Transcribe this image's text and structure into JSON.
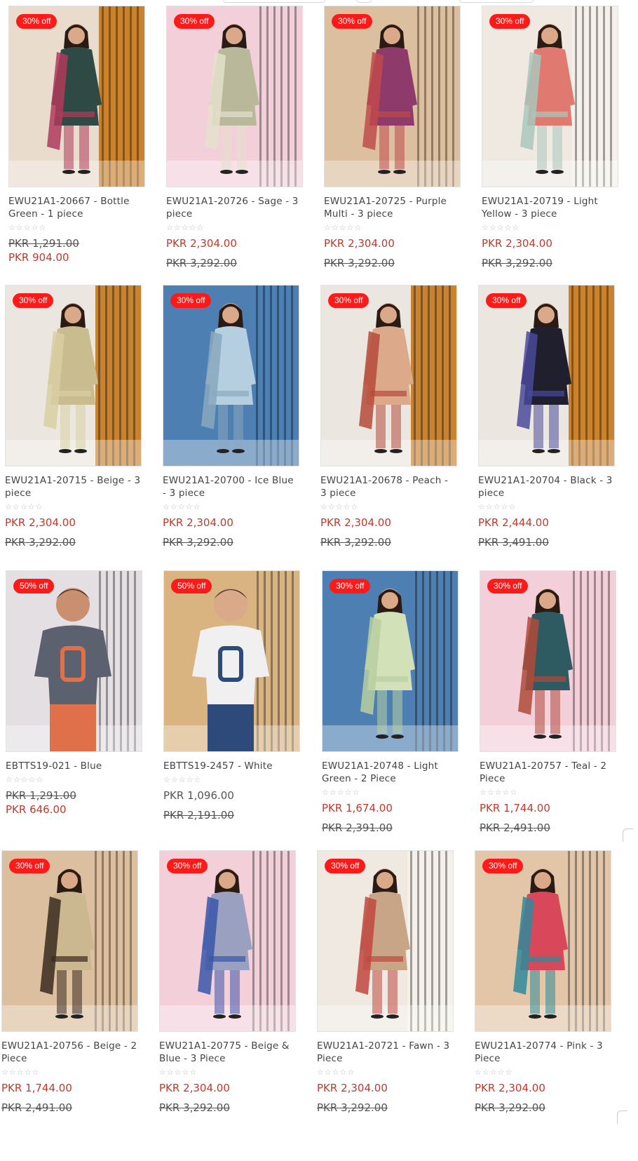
{
  "products": [
    {
      "badge": "30% off",
      "title": "EWU21A1-20667 - Bottle Green - 1 piece",
      "price": "PKR 904.00",
      "old_price": "PKR 1,291.00",
      "layout": "inline",
      "bg": "#e9dccd",
      "dress": "#2f4a45",
      "accent": "#b03a5b",
      "curtain": "#c9822e",
      "skin": "#d9a98a"
    },
    {
      "badge": "30% off",
      "title": "EWU21A1-20726 - Sage - 3 piece",
      "price": "PKR 2,304.00",
      "old_price": "PKR 3,292.00",
      "layout": "stack",
      "bg": "#f3cfda",
      "dress": "#b9b89a",
      "accent": "#e4e0cc",
      "curtain": "#f3cfda",
      "skin": "#d9a98a"
    },
    {
      "badge": "30% off",
      "title": "EWU21A1-20725 - Purple Multi - 3 piece",
      "price": "PKR 2,304.00",
      "old_price": "PKR 3,292.00",
      "layout": "stack",
      "bg": "#dcbf9e",
      "dress": "#8e3a6a",
      "accent": "#c04a4a",
      "curtain": "#dcbf9e",
      "skin": "#d9a98a"
    },
    {
      "badge": "30% off",
      "title": "EWU21A1-20719 - Light Yellow - 3 piece",
      "price": "PKR 2,304.00",
      "old_price": "PKR 3,292.00",
      "layout": "stack",
      "bg": "#efe9e2",
      "dress": "#e0796f",
      "accent": "#a9c7bb",
      "curtain": "#f5f1ea",
      "skin": "#d9a98a"
    },
    {
      "badge": "30% off",
      "title": "EWU21A1-20715 - Beige - 3 piece",
      "price": "PKR 2,304.00",
      "old_price": "PKR 3,292.00",
      "layout": "stack",
      "bg": "#ece6e0",
      "dress": "#c9bd90",
      "accent": "#d8cfa2",
      "curtain": "#c9822e",
      "skin": "#d9a98a"
    },
    {
      "badge": "30% off",
      "title": "EWU21A1-20700 - Ice Blue - 3 piece",
      "price": "PKR 2,304.00",
      "old_price": "PKR 3,292.00",
      "layout": "stack",
      "bg": "#4d7fb2",
      "dress": "#b6cfe0",
      "accent": "#8aa8bd",
      "curtain": "#4d7fb2",
      "skin": "#d9a98a"
    },
    {
      "badge": "30% off",
      "title": "EWU21A1-20678 - Peach - 3 piece",
      "price": "PKR 2,304.00",
      "old_price": "PKR 3,292.00",
      "layout": "stack",
      "bg": "#ece6e0",
      "dress": "#dca98b",
      "accent": "#b54a3a",
      "curtain": "#c9822e",
      "skin": "#d9a98a"
    },
    {
      "badge": "30% off",
      "title": "EWU21A1-20704 - Black - 3 piece",
      "price": "PKR 2,444.00",
      "old_price": "PKR 3,491.00",
      "layout": "stack",
      "bg": "#ece6e0",
      "dress": "#1f1f2e",
      "accent": "#4a4a9a",
      "curtain": "#c9822e",
      "skin": "#d9a98a"
    },
    {
      "badge": "50% off",
      "title": "EBTTS19-021 - Blue",
      "price": "PKR 646.00",
      "old_price": "PKR 1,291.00",
      "layout": "inline",
      "bg": "#e4dfe3",
      "dress": "#5c6170",
      "accent": "#e0704a",
      "curtain": "#e4dfe3",
      "skin": "#c98f6e"
    },
    {
      "badge": "50% off",
      "title": "EBTTS19-2457 - White",
      "price": "PKR 1,096.00",
      "old_price": "PKR 2,191.00",
      "layout": "stack-plain",
      "bg": "#d9b481",
      "dress": "#f0f0f0",
      "accent": "#2e4a7a",
      "curtain": "#d9b481",
      "skin": "#d9a98a"
    },
    {
      "badge": "30% off",
      "title": "EWU21A1-20748 - Light Green - 2 Piece",
      "price": "PKR 1,674.00",
      "old_price": "PKR 2,391.00",
      "layout": "stack",
      "bg": "#4d7fb2",
      "dress": "#d3e1b8",
      "accent": "#b8cfa0",
      "curtain": "#4d7fb2",
      "skin": "#d9a98a"
    },
    {
      "badge": "30% off",
      "title": "EWU21A1-20757 - Teal - 2 Piece",
      "price": "PKR 1,744.00",
      "old_price": "PKR 2,491.00",
      "layout": "stack",
      "bg": "#f3cfda",
      "dress": "#2e5a62",
      "accent": "#b04a3a",
      "curtain": "#f3cfda",
      "skin": "#d9a98a"
    },
    {
      "badge": "30% off",
      "title": "EWU21A1-20756 - Beige - 2 Piece",
      "price": "PKR 1,744.00",
      "old_price": "PKR 2,491.00",
      "layout": "stack",
      "bg": "#dcbf9e",
      "dress": "#cbb890",
      "accent": "#3a2a20",
      "curtain": "#dcbf9e",
      "skin": "#d9a98a"
    },
    {
      "badge": "30% off",
      "title": "EWU21A1-20775 - Beige & Blue - 3 Piece",
      "price": "PKR 2,304.00",
      "old_price": "PKR 3,292.00",
      "layout": "stack",
      "bg": "#f3cfda",
      "dress": "#9aa0c0",
      "accent": "#3a56a8",
      "curtain": "#f3cfda",
      "skin": "#d9a98a"
    },
    {
      "badge": "30% off",
      "title": "EWU21A1-20721 - Fawn - 3 Piece",
      "price": "PKR 2,304.00",
      "old_price": "PKR 3,292.00",
      "layout": "stack",
      "bg": "#efe9e2",
      "dress": "#c9a587",
      "accent": "#c0473e",
      "curtain": "#f5f1ea",
      "skin": "#d9a98a"
    },
    {
      "badge": "30% off",
      "title": "EWU21A1-20774 - Pink - 3 Piece",
      "price": "PKR 2,304.00",
      "old_price": "PKR 3,292.00",
      "layout": "stack",
      "bg": "#e3c6a8",
      "dress": "#d9485a",
      "accent": "#2f8a9a",
      "curtain": "#e3c6a8",
      "skin": "#d9a98a"
    }
  ],
  "rating_stars": "☆☆☆☆☆",
  "colors": {
    "badge": "#ff1a1a",
    "price": "#c0392b",
    "old_price": "#555555"
  }
}
